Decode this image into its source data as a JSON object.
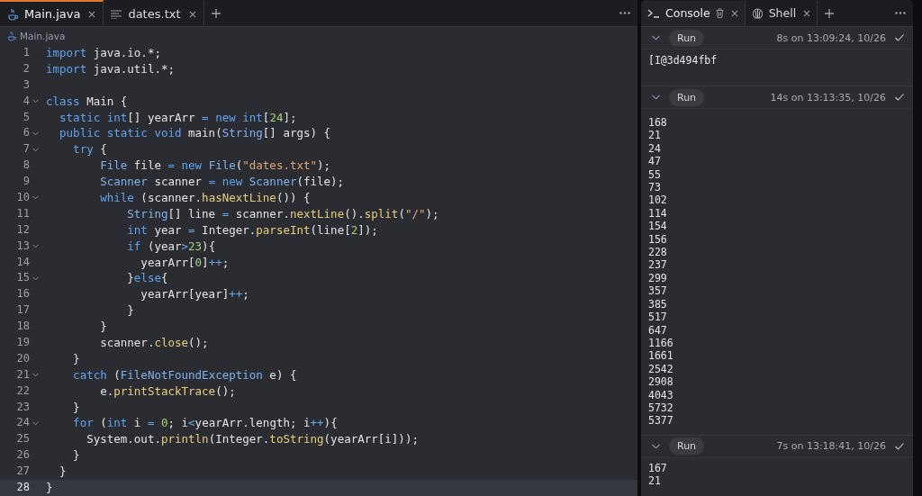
{
  "editor": {
    "tabs": [
      {
        "label": "Main.java",
        "kind": "java",
        "selected": true
      },
      {
        "label": "dates.txt",
        "kind": "text",
        "selected": false
      }
    ],
    "breadcrumb": "Main.java",
    "lines": [
      {
        "n": "1",
        "fold": false,
        "current": false,
        "tokens": [
          {
            "text": "import",
            "kind": "kw"
          },
          {
            "text": " java.io.*;",
            "kind": "plain"
          }
        ]
      },
      {
        "n": "2",
        "fold": false,
        "current": false,
        "tokens": [
          {
            "text": "import",
            "kind": "kw"
          },
          {
            "text": " java.util.*;",
            "kind": "plain"
          }
        ]
      },
      {
        "n": "3",
        "fold": false,
        "current": false
      },
      {
        "n": "4",
        "fold": true,
        "current": false,
        "tokens": [
          {
            "text": "class",
            "kind": "kw"
          },
          {
            "text": " Main {",
            "kind": "plain"
          }
        ]
      },
      {
        "n": "5",
        "fold": false,
        "current": false,
        "tokens": [
          {
            "text": "  static int",
            "kind": "kw"
          },
          {
            "text": "[] yearArr ",
            "kind": "plain"
          },
          {
            "text": "= new int",
            "kind": "kw"
          },
          {
            "text": "[",
            "kind": "plain"
          },
          {
            "text": "24",
            "kind": "num"
          },
          {
            "text": "];",
            "kind": "plain"
          }
        ]
      },
      {
        "n": "6",
        "fold": true,
        "current": false,
        "tokens": [
          {
            "text": "  public static void",
            "kind": "kw"
          },
          {
            "text": " main(",
            "kind": "plain"
          },
          {
            "text": "String",
            "kind": "type"
          },
          {
            "text": "[] args) {",
            "kind": "plain"
          }
        ]
      },
      {
        "n": "7",
        "fold": true,
        "current": false,
        "tokens": [
          {
            "text": "    try",
            "kind": "kw"
          },
          {
            "text": " {",
            "kind": "plain"
          }
        ]
      },
      {
        "n": "8",
        "fold": false,
        "current": false,
        "tokens": [
          {
            "text": "        File",
            "kind": "type"
          },
          {
            "text": " file ",
            "kind": "plain"
          },
          {
            "text": "= new ",
            "kind": "kw"
          },
          {
            "text": "File",
            "kind": "type"
          },
          {
            "text": "(",
            "kind": "plain"
          },
          {
            "text": "\"dates.txt\"",
            "kind": "str"
          },
          {
            "text": ");",
            "kind": "plain"
          }
        ]
      },
      {
        "n": "9",
        "fold": false,
        "current": false,
        "tokens": [
          {
            "text": "        Scanner",
            "kind": "type"
          },
          {
            "text": " scanner ",
            "kind": "plain"
          },
          {
            "text": "= new ",
            "kind": "kw"
          },
          {
            "text": "Scanner",
            "kind": "type"
          },
          {
            "text": "(file);",
            "kind": "plain"
          }
        ]
      },
      {
        "n": "10",
        "fold": true,
        "current": false,
        "tokens": [
          {
            "text": "        while",
            "kind": "kw"
          },
          {
            "text": " (scanner.",
            "kind": "plain"
          },
          {
            "text": "hasNextLine",
            "kind": "fn"
          },
          {
            "text": "()) {",
            "kind": "plain"
          }
        ]
      },
      {
        "n": "11",
        "fold": false,
        "current": false,
        "tokens": [
          {
            "text": "            String",
            "kind": "type"
          },
          {
            "text": "[] line ",
            "kind": "plain"
          },
          {
            "text": "=",
            "kind": "op"
          },
          {
            "text": " scanner.",
            "kind": "plain"
          },
          {
            "text": "nextLine",
            "kind": "fn"
          },
          {
            "text": "().",
            "kind": "plain"
          },
          {
            "text": "split",
            "kind": "fn"
          },
          {
            "text": "(",
            "kind": "plain"
          },
          {
            "text": "\"/\"",
            "kind": "str"
          },
          {
            "text": ");",
            "kind": "plain"
          }
        ]
      },
      {
        "n": "12",
        "fold": false,
        "current": false,
        "tokens": [
          {
            "text": "            int",
            "kind": "kw"
          },
          {
            "text": " year ",
            "kind": "plain"
          },
          {
            "text": "=",
            "kind": "op"
          },
          {
            "text": " Integer.",
            "kind": "plain"
          },
          {
            "text": "parseInt",
            "kind": "fn"
          },
          {
            "text": "(line[",
            "kind": "plain"
          },
          {
            "text": "2",
            "kind": "num"
          },
          {
            "text": "]);",
            "kind": "plain"
          }
        ]
      },
      {
        "n": "13",
        "fold": true,
        "current": false,
        "tokens": [
          {
            "text": "            if",
            "kind": "kw"
          },
          {
            "text": " (year",
            "kind": "plain"
          },
          {
            "text": ">",
            "kind": "op"
          },
          {
            "text": "23",
            "kind": "num"
          },
          {
            "text": "){",
            "kind": "plain"
          }
        ]
      },
      {
        "n": "14",
        "fold": false,
        "current": false,
        "tokens": [
          {
            "text": "              yearArr[",
            "kind": "plain"
          },
          {
            "text": "0",
            "kind": "num"
          },
          {
            "text": "]",
            "kind": "plain"
          },
          {
            "text": "++",
            "kind": "op"
          },
          {
            "text": ";",
            "kind": "plain"
          }
        ]
      },
      {
        "n": "15",
        "fold": true,
        "current": false,
        "tokens": [
          {
            "text": "            }",
            "kind": "plain"
          },
          {
            "text": "else",
            "kind": "kw"
          },
          {
            "text": "{",
            "kind": "plain"
          }
        ]
      },
      {
        "n": "16",
        "fold": false,
        "current": false,
        "tokens": [
          {
            "text": "              yearArr[year]",
            "kind": "plain"
          },
          {
            "text": "++",
            "kind": "op"
          },
          {
            "text": ";",
            "kind": "plain"
          }
        ]
      },
      {
        "n": "17",
        "fold": false,
        "current": false,
        "tokens": [
          {
            "text": "            }",
            "kind": "plain"
          }
        ]
      },
      {
        "n": "18",
        "fold": false,
        "current": false,
        "tokens": [
          {
            "text": "        }",
            "kind": "plain"
          }
        ]
      },
      {
        "n": "19",
        "fold": false,
        "current": false,
        "tokens": [
          {
            "text": "        scanner.",
            "kind": "plain"
          },
          {
            "text": "close",
            "kind": "fn"
          },
          {
            "text": "();",
            "kind": "plain"
          }
        ]
      },
      {
        "n": "20",
        "fold": false,
        "current": false,
        "tokens": [
          {
            "text": "    }",
            "kind": "plain"
          }
        ]
      },
      {
        "n": "21",
        "fold": true,
        "current": false,
        "tokens": [
          {
            "text": "    catch",
            "kind": "kw"
          },
          {
            "text": " (",
            "kind": "plain"
          },
          {
            "text": "FileNotFoundException",
            "kind": "type"
          },
          {
            "text": " e) {",
            "kind": "plain"
          }
        ]
      },
      {
        "n": "22",
        "fold": false,
        "current": false,
        "tokens": [
          {
            "text": "        e.",
            "kind": "plain"
          },
          {
            "text": "printStackTrace",
            "kind": "fn"
          },
          {
            "text": "();",
            "kind": "plain"
          }
        ]
      },
      {
        "n": "23",
        "fold": false,
        "current": false,
        "tokens": [
          {
            "text": "    }",
            "kind": "plain"
          }
        ]
      },
      {
        "n": "24",
        "fold": true,
        "current": false,
        "tokens": [
          {
            "text": "    for",
            "kind": "kw"
          },
          {
            "text": " (",
            "kind": "plain"
          },
          {
            "text": "int",
            "kind": "kw"
          },
          {
            "text": " i ",
            "kind": "plain"
          },
          {
            "text": "= ",
            "kind": "op"
          },
          {
            "text": "0",
            "kind": "num"
          },
          {
            "text": "; i",
            "kind": "plain"
          },
          {
            "text": "<",
            "kind": "op"
          },
          {
            "text": "yearArr.length; i",
            "kind": "plain"
          },
          {
            "text": "++",
            "kind": "op"
          },
          {
            "text": "){",
            "kind": "plain"
          }
        ]
      },
      {
        "n": "25",
        "fold": false,
        "current": false,
        "tokens": [
          {
            "text": "      System.out.",
            "kind": "plain"
          },
          {
            "text": "println",
            "kind": "fn"
          },
          {
            "text": "(Integer.",
            "kind": "plain"
          },
          {
            "text": "toString",
            "kind": "fn"
          },
          {
            "text": "(yearArr[i]));",
            "kind": "plain"
          }
        ]
      },
      {
        "n": "26",
        "fold": false,
        "current": false,
        "tokens": [
          {
            "text": "    }",
            "kind": "plain"
          }
        ]
      },
      {
        "n": "27",
        "fold": false,
        "current": false,
        "tokens": [
          {
            "text": "  }",
            "kind": "plain"
          }
        ]
      },
      {
        "n": "28",
        "fold": false,
        "current": true,
        "tokens": [
          {
            "text": "}",
            "kind": "plain"
          }
        ]
      }
    ]
  },
  "console": {
    "tabs": [
      {
        "label": "Console",
        "kind": "console",
        "selected": true
      },
      {
        "label": "Shell",
        "kind": "shell",
        "selected": false
      }
    ],
    "runs": [
      {
        "button": "Run",
        "time": "8s on 13:09:24, 10/26",
        "output": [
          "[I@3d494fbf"
        ]
      },
      {
        "button": "Run",
        "time": "14s on 13:13:35, 10/26",
        "output": [
          "168",
          "21",
          "24",
          "47",
          "55",
          "73",
          "102",
          "114",
          "154",
          "156",
          "228",
          "237",
          "299",
          "357",
          "385",
          "517",
          "647",
          "1166",
          "1661",
          "2542",
          "2908",
          "4043",
          "5732",
          "5377"
        ]
      },
      {
        "button": "Run",
        "time": "7s on 13:18:41, 10/26",
        "output": [
          "167",
          "21"
        ]
      }
    ]
  }
}
